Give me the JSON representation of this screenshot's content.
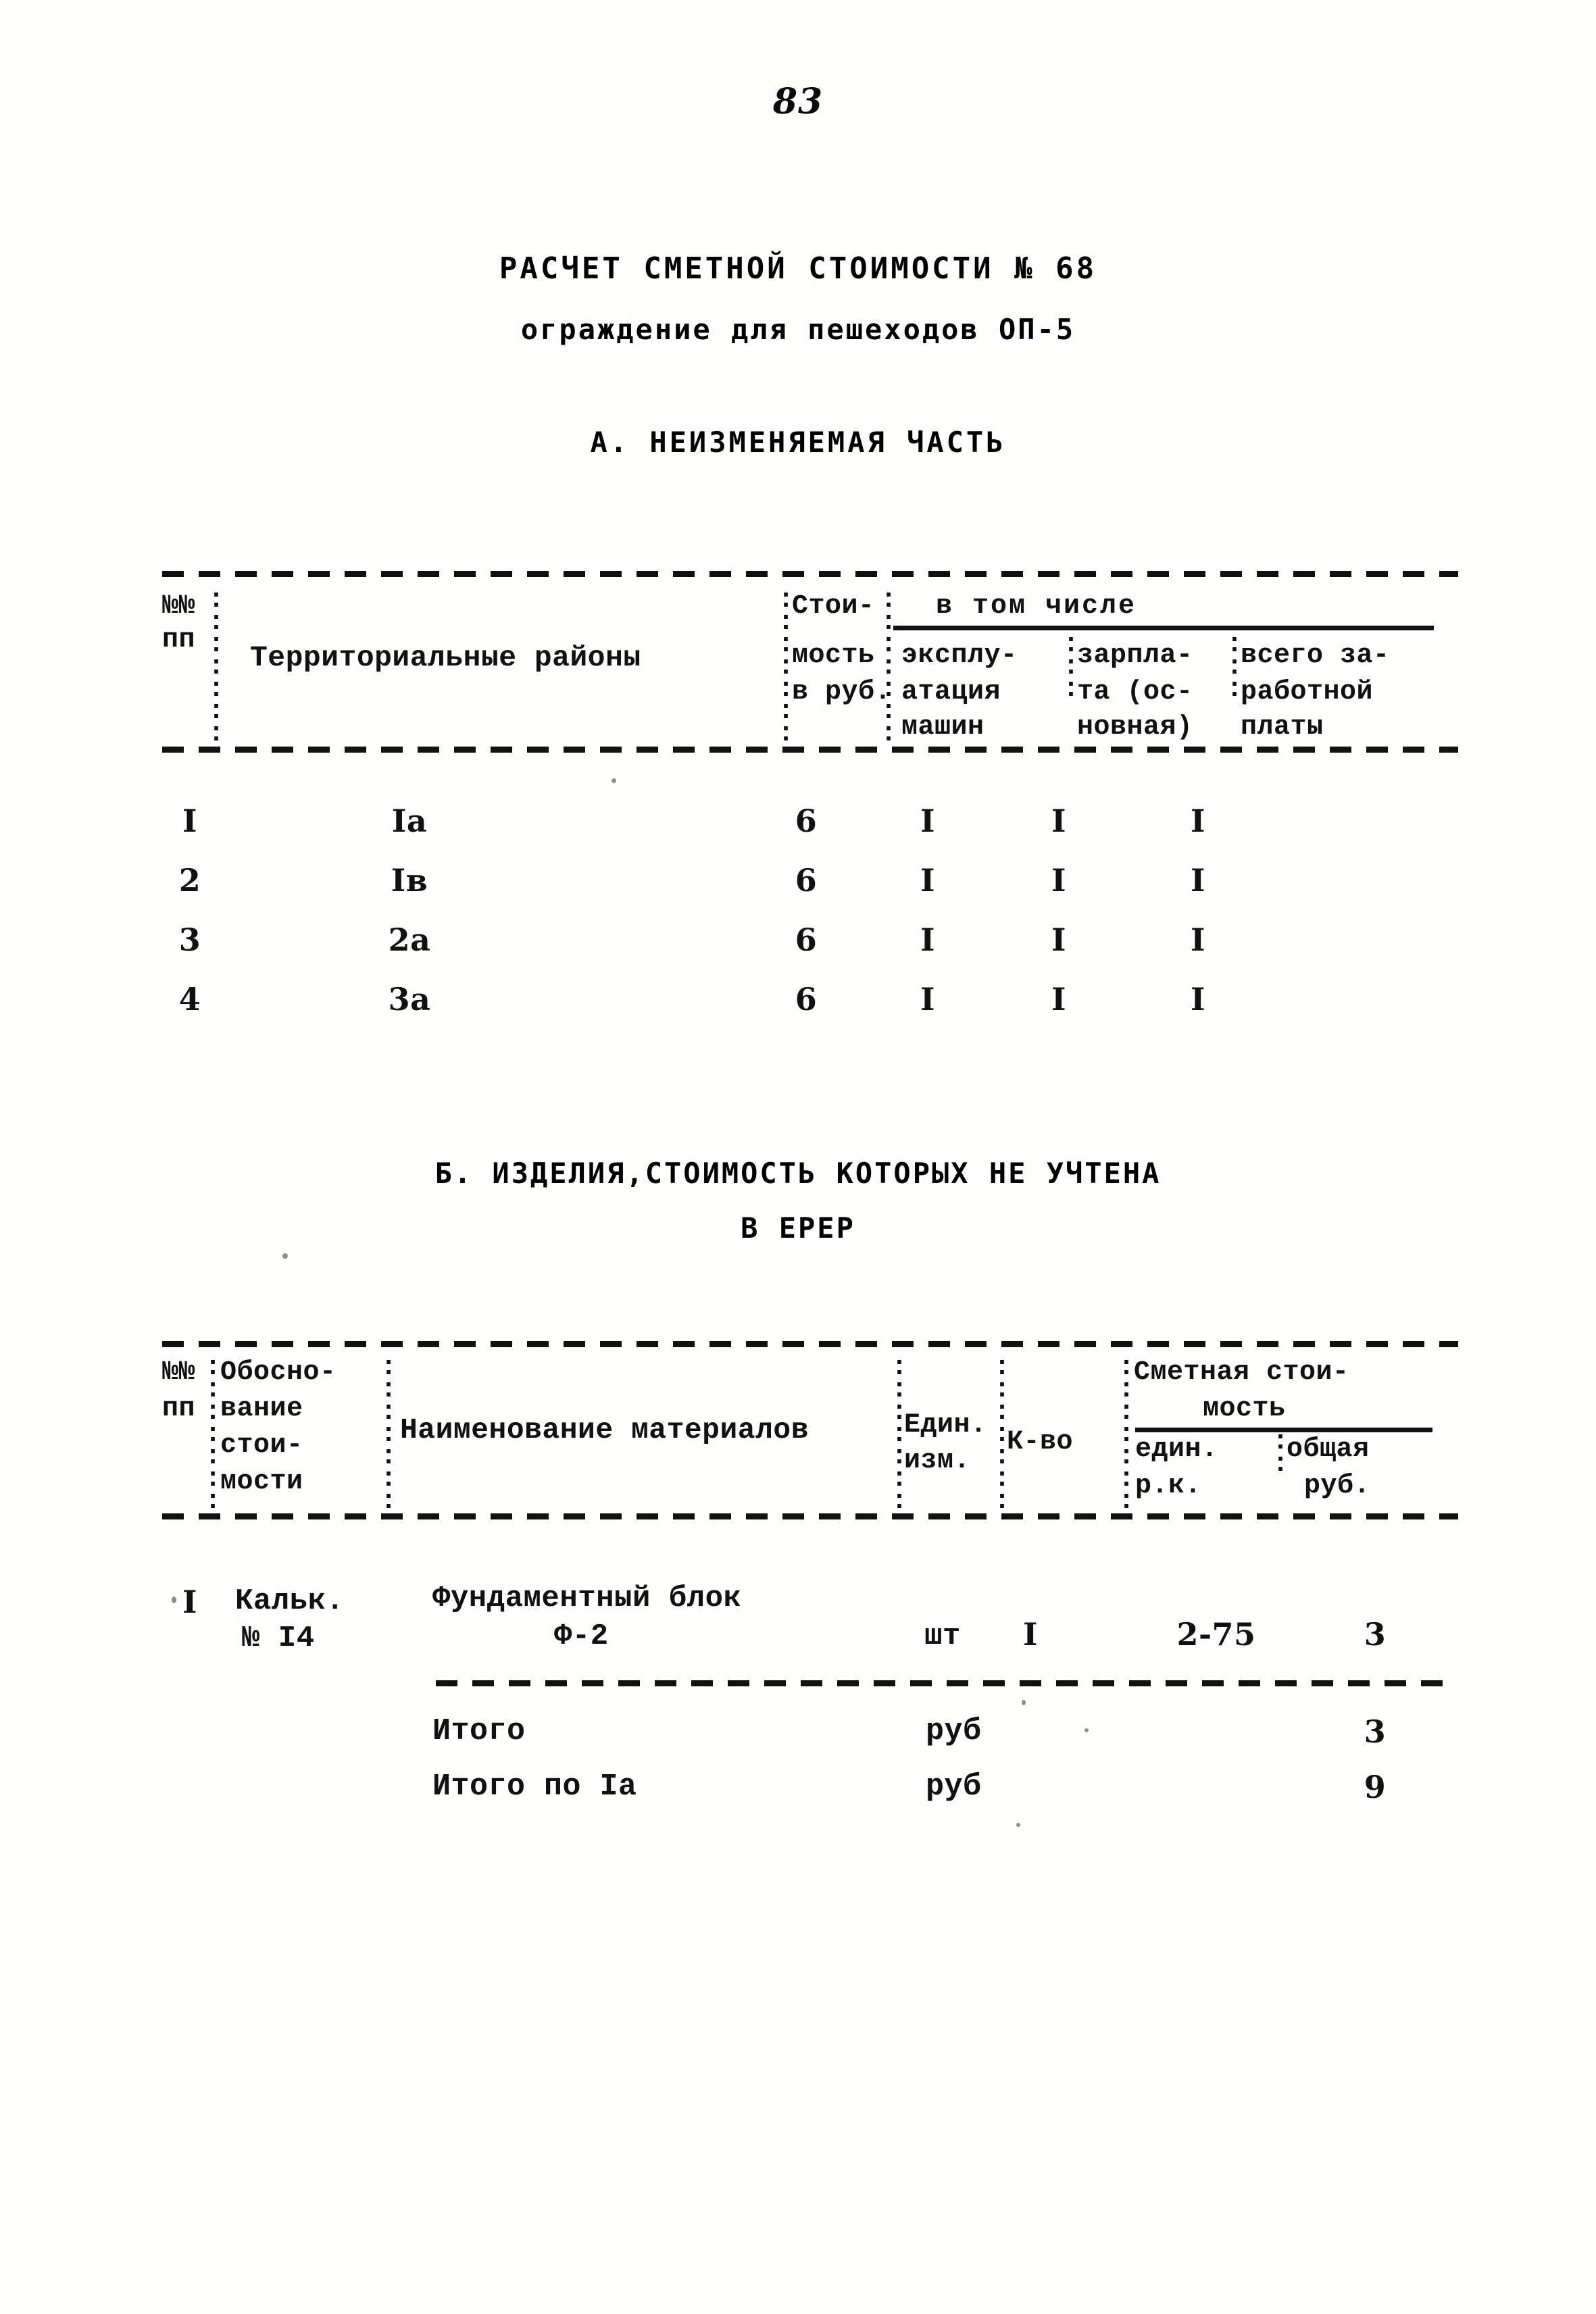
{
  "page": {
    "number": "83"
  },
  "document": {
    "title": "РАСЧЕТ СМЕТНОЙ СТОИМОСТИ № 68",
    "subtitle": "ограждение для пешеходов ОП-5"
  },
  "section_a": {
    "heading": "А. НЕИЗМЕНЯЕМАЯ ЧАСТЬ",
    "header": {
      "col_no": "№№",
      "col_no_2": "пп",
      "col_districts": "Территориальные районы",
      "col_cost_1": "Стои-",
      "col_cost_2": "мость",
      "col_cost_3": "в руб.",
      "group_title": "в том числе",
      "sub_machines_1": "эксплу-",
      "sub_machines_2": "атация",
      "sub_machines_3": "машин",
      "sub_wages_1": "зарпла-",
      "sub_wages_2": "та (ос-",
      "sub_wages_3": "новная)",
      "sub_total_1": "всего за-",
      "sub_total_2": "работной",
      "sub_total_3": "платы"
    },
    "rows": [
      {
        "no": "I",
        "district": "Iа",
        "cost": "6",
        "machines": "I",
        "wages": "I",
        "total_wages": "I"
      },
      {
        "no": "2",
        "district": "Iв",
        "cost": "6",
        "machines": "I",
        "wages": "I",
        "total_wages": "I"
      },
      {
        "no": "3",
        "district": "2а",
        "cost": "6",
        "machines": "I",
        "wages": "I",
        "total_wages": "I"
      },
      {
        "no": "4",
        "district": "3а",
        "cost": "6",
        "machines": "I",
        "wages": "I",
        "total_wages": "I"
      }
    ]
  },
  "section_b": {
    "heading_line1": "Б. ИЗДЕЛИЯ,СТОИМОСТЬ КОТОРЫХ НЕ УЧТЕНА",
    "heading_line2": "В ЕРЕР",
    "header": {
      "col_no": "№№",
      "col_no_2": "пп",
      "col_basis_1": "Обосно-",
      "col_basis_2": "вание",
      "col_basis_3": "стои-",
      "col_basis_4": "мости",
      "col_materials": "Наименование материалов",
      "col_unit_1": "Един.",
      "col_unit_2": "изм.",
      "col_qty": "К-во",
      "group_title_1": "Сметная стои-",
      "group_title_2": "мость",
      "sub_unit_1": "един.",
      "sub_unit_2": "р.к.",
      "sub_total_1": "общая",
      "sub_total_2": "руб."
    },
    "rows": [
      {
        "no": "I",
        "basis_1": "Кальк.",
        "basis_2": "№ I4",
        "material_1": "Фундаментный блок",
        "material_2": "Ф-2",
        "unit": "шт",
        "qty": "I",
        "price_unit": "2-75",
        "price_total": "3"
      }
    ],
    "totals": [
      {
        "label": "Итого",
        "unit": "руб",
        "value": "3"
      },
      {
        "label": "Итого по Iа",
        "unit": "руб",
        "value": "9"
      }
    ]
  }
}
